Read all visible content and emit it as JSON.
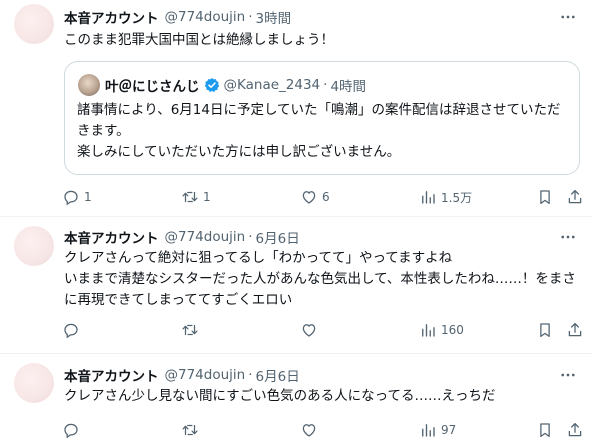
{
  "tweets": [
    {
      "name": "本音アカウント",
      "handle": "@774doujin",
      "dot": "·",
      "time": "3時間",
      "text": "このまま犯罪大国中国とは絶縁しましょう！",
      "quote": {
        "name": "叶＠にじさんじ",
        "handle": "@Kanae_2434",
        "dot": "·",
        "time": "4時間",
        "text": "諸事情により、6月14日に予定していた「鳴潮」の案件配信は辞退させていただきます。\n楽しみにしていただいた方には申し訳ございません。"
      },
      "replies": "1",
      "retweets": "1",
      "likes": "6",
      "views": "1.5万"
    },
    {
      "name": "本音アカウント",
      "handle": "@774doujin",
      "dot": "·",
      "time": "6月6日",
      "text": "クレアさんって絶対に狙ってるし「わかってて」やってますよね\nいままで清楚なシスターだった人があんな色気出して、本性表したわね……！をまさに再現できてしまっててすごくエロい",
      "replies": "",
      "retweets": "",
      "likes": "",
      "views": "160"
    },
    {
      "name": "本音アカウント",
      "handle": "@774doujin",
      "dot": "·",
      "time": "6月6日",
      "text": "クレアさん少し見ない間にすごい色気のある人になってる……えっちだ",
      "replies": "",
      "retweets": "",
      "likes": "",
      "views": "97"
    }
  ],
  "icons": {
    "more": "more-icon",
    "reply": "reply-icon",
    "retweet": "retweet-icon",
    "like": "like-icon",
    "views": "views-icon",
    "bookmark": "bookmark-icon",
    "share": "share-icon",
    "verified": "verified-badge-icon"
  },
  "colors": {
    "text": "#0f1419",
    "secondary": "#536471",
    "verified": "#1d9bf0",
    "border": "#cfd9de",
    "divider": "#eff3f4"
  }
}
